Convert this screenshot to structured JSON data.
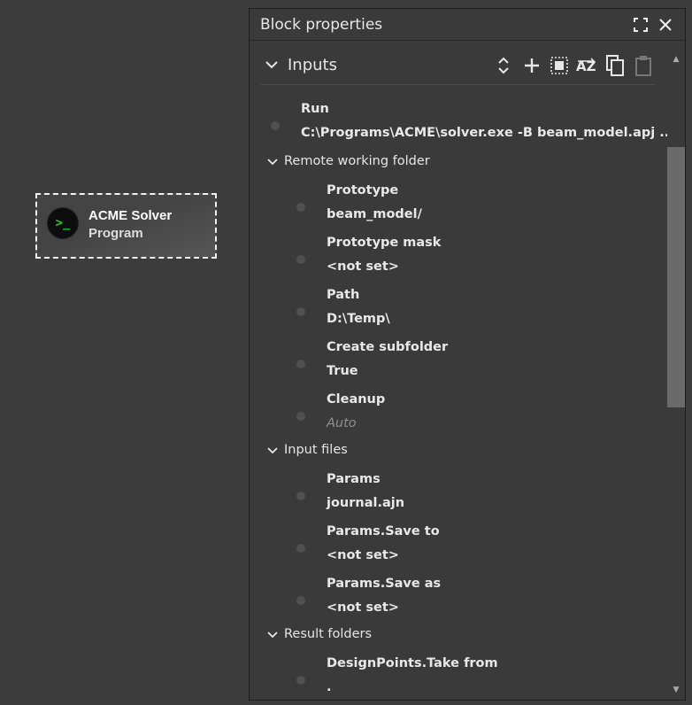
{
  "canvas": {
    "block": {
      "title": "ACME Solver",
      "subtitle": "Program",
      "icon": "terminal-icon",
      "glyph": ">_"
    }
  },
  "panel": {
    "title": "Block properties",
    "header_icons": [
      "expand-icon",
      "close-icon"
    ],
    "section": {
      "label": "Inputs",
      "tools": [
        "sort-updown-icon",
        "add-icon",
        "select-all-icon",
        "sort-az-icon",
        "copy-icon",
        "paste-icon"
      ]
    },
    "run": {
      "name": "Run",
      "value": "C:\\Programs\\ACME\\solver.exe -B beam_model.apj ..."
    },
    "groups": [
      {
        "label": "Remote working folder",
        "items": [
          {
            "name": "Prototype",
            "value": "beam_model/"
          },
          {
            "name": "Prototype mask",
            "value": "<not set>"
          },
          {
            "name": "Path",
            "value": "D:\\Temp\\"
          },
          {
            "name": "Create subfolder",
            "value": "True"
          },
          {
            "name": "Cleanup",
            "value": "Auto"
          }
        ]
      },
      {
        "label": "Input files",
        "items": [
          {
            "name": "Params",
            "value": "journal.ajn"
          },
          {
            "name": "Params.Save to",
            "value": "<not set>"
          },
          {
            "name": "Params.Save as",
            "value": "<not set>"
          }
        ]
      },
      {
        "label": "Result folders",
        "items": [
          {
            "name": "DesignPoints.Take from",
            "value": "."
          }
        ]
      }
    ]
  }
}
